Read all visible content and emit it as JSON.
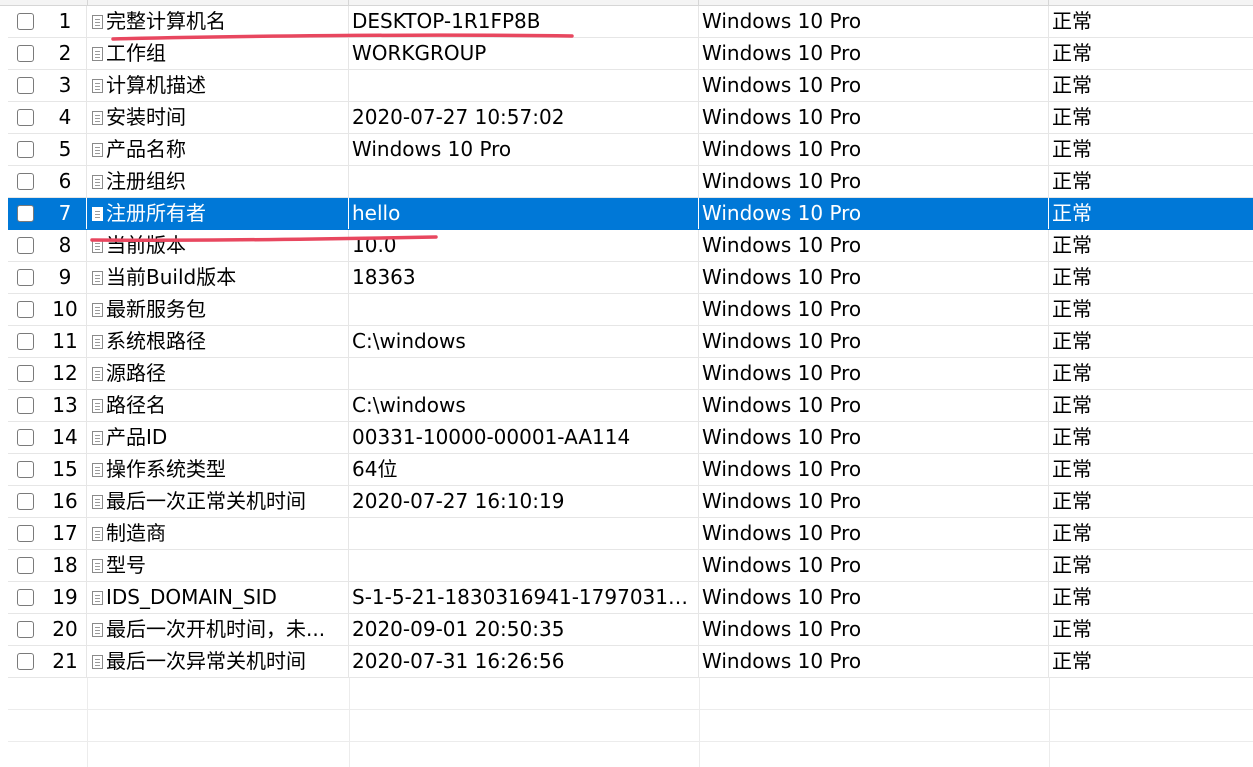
{
  "table": {
    "rows": [
      {
        "num": "1",
        "name": "完整计算机名",
        "value": "DESKTOP-1R1FP8B",
        "os": "Windows 10 Pro",
        "status": "正常"
      },
      {
        "num": "2",
        "name": "工作组",
        "value": "WORKGROUP",
        "os": "Windows 10 Pro",
        "status": "正常"
      },
      {
        "num": "3",
        "name": "计算机描述",
        "value": "",
        "os": "Windows 10 Pro",
        "status": "正常"
      },
      {
        "num": "4",
        "name": "安装时间",
        "value": "2020-07-27 10:57:02",
        "os": "Windows 10 Pro",
        "status": "正常"
      },
      {
        "num": "5",
        "name": "产品名称",
        "value": "Windows 10 Pro",
        "os": "Windows 10 Pro",
        "status": "正常"
      },
      {
        "num": "6",
        "name": "注册组织",
        "value": "",
        "os": "Windows 10 Pro",
        "status": "正常"
      },
      {
        "num": "7",
        "name": "注册所有者",
        "value": "hello",
        "os": "Windows 10 Pro",
        "status": "正常",
        "selected": true
      },
      {
        "num": "8",
        "name": "当前版本",
        "value": "10.0",
        "os": "Windows 10 Pro",
        "status": "正常"
      },
      {
        "num": "9",
        "name": "当前Build版本",
        "value": "18363",
        "os": "Windows 10 Pro",
        "status": "正常"
      },
      {
        "num": "10",
        "name": "最新服务包",
        "value": "",
        "os": "Windows 10 Pro",
        "status": "正常"
      },
      {
        "num": "11",
        "name": "系统根路径",
        "value": "C:\\windows",
        "os": "Windows 10 Pro",
        "status": "正常"
      },
      {
        "num": "12",
        "name": "源路径",
        "value": "",
        "os": "Windows 10 Pro",
        "status": "正常"
      },
      {
        "num": "13",
        "name": "路径名",
        "value": "C:\\windows",
        "os": "Windows 10 Pro",
        "status": "正常"
      },
      {
        "num": "14",
        "name": "产品ID",
        "value": "00331-10000-00001-AA114",
        "os": "Windows 10 Pro",
        "status": "正常"
      },
      {
        "num": "15",
        "name": "操作系统类型",
        "value": "64位",
        "os": "Windows 10 Pro",
        "status": "正常"
      },
      {
        "num": "16",
        "name": "最后一次正常关机时间",
        "value": "2020-07-27 16:10:19",
        "os": "Windows 10 Pro",
        "status": "正常"
      },
      {
        "num": "17",
        "name": "制造商",
        "value": "",
        "os": "Windows 10 Pro",
        "status": "正常"
      },
      {
        "num": "18",
        "name": "型号",
        "value": "",
        "os": "Windows 10 Pro",
        "status": "正常"
      },
      {
        "num": "19",
        "name": "IDS_DOMAIN_SID",
        "value": "S-1-5-21-1830316941-17970310...",
        "os": "Windows 10 Pro",
        "status": "正常"
      },
      {
        "num": "20",
        "name": "最后一次开机时间，未...",
        "value": "2020-09-01 20:50:35",
        "os": "Windows 10 Pro",
        "status": "正常"
      },
      {
        "num": "21",
        "name": "最后一次异常关机时间",
        "value": "2020-07-31 16:26:56",
        "os": "Windows 10 Pro",
        "status": "正常"
      }
    ],
    "empty_rows": 3
  },
  "annotations": {
    "underline_color": "#e8475f"
  },
  "colors": {
    "selection": "#0078d7",
    "gridline": "#e6e6e6"
  }
}
